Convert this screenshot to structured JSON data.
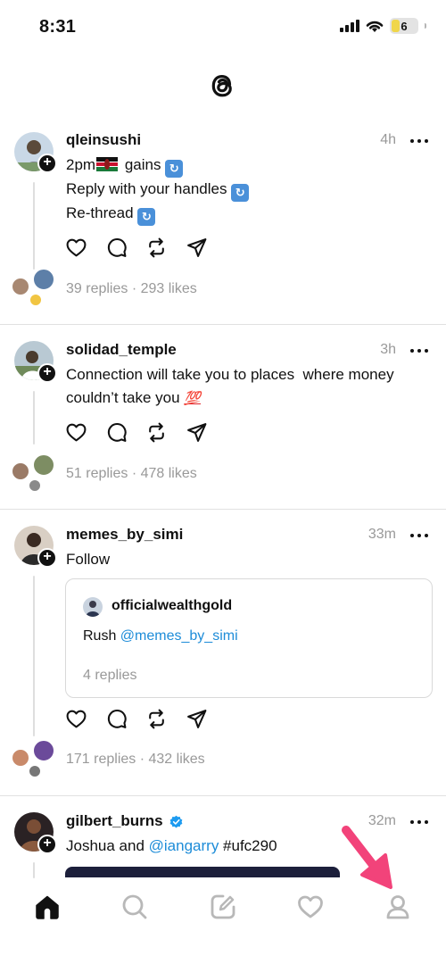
{
  "status_bar": {
    "time": "8:31",
    "battery_level": "6"
  },
  "app": {
    "logo_icon": "threads-logo-icon"
  },
  "posts": [
    {
      "username": "qleinsushi",
      "time": "4h",
      "lines": [
        "2pm",
        "gains",
        "Reply with your handles",
        "Re-thread"
      ],
      "flag_icon": "kenya-flag-icon",
      "repost_emoji": "repeat-emoji-icon",
      "replies": "39 replies",
      "likes": "293 likes",
      "separator": " · "
    },
    {
      "username": "solidad_temple",
      "time": "3h",
      "lines": [
        "Connection will take you to places  where money",
        "couldn’t take you"
      ],
      "emoji": "💯",
      "replies": "51 replies",
      "likes": "478 likes",
      "separator": " · "
    },
    {
      "username": "memes_by_simi",
      "time": "33m",
      "lines": [
        "Follow"
      ],
      "quote": {
        "username": "officialwealthgold",
        "text_prefix": "Rush ",
        "mention": "@memes_by_simi",
        "replies": "4 replies"
      },
      "replies": "171 replies",
      "likes": "432 likes",
      "separator": " · "
    },
    {
      "username": "gilbert_burns",
      "verified": true,
      "time": "32m",
      "text_prefix": "Joshua and ",
      "mention": "@iangarry",
      "hashtag": " #ufc290"
    }
  ],
  "tab_bar": {
    "tabs": [
      "home-icon",
      "search-icon",
      "compose-icon",
      "activity-heart-icon",
      "profile-icon"
    ],
    "active": "home-icon"
  },
  "colors": {
    "link": "#1d8cd8",
    "muted": "#999999",
    "divider": "#e1e1e1",
    "annotation_arrow": "#f2437a"
  }
}
